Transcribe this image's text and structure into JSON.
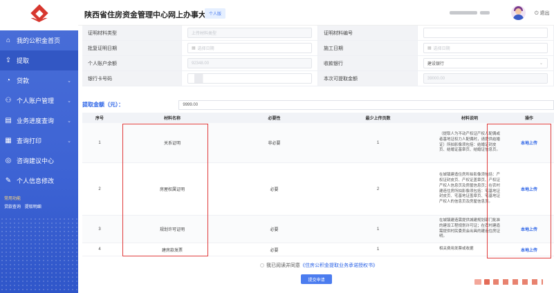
{
  "sidebar": {
    "items": [
      {
        "label": "我的公积金首页",
        "icon": "home-icon",
        "glyph": "⌂",
        "chevron": false
      },
      {
        "label": "提取",
        "icon": "withdraw-icon",
        "glyph": "⇪",
        "chevron": false
      },
      {
        "label": "贷款",
        "icon": "loan-icon",
        "glyph": "◔",
        "chevron": true
      },
      {
        "label": "个人账户管理",
        "icon": "user-icon",
        "glyph": "⚇",
        "chevron": true
      },
      {
        "label": "业务进度查询",
        "icon": "progress-icon",
        "glyph": "▤",
        "chevron": true
      },
      {
        "label": "查询打印",
        "icon": "print-icon",
        "glyph": "▦",
        "chevron": true
      },
      {
        "label": "咨询建议中心",
        "icon": "chat-icon",
        "glyph": "◎",
        "chevron": false
      },
      {
        "label": "个人信息修改",
        "icon": "edit-icon",
        "glyph": "✎",
        "chevron": false
      }
    ],
    "common_title": "常用功能",
    "common_links": [
      "贷款查询",
      "提取明细"
    ]
  },
  "header": {
    "title": "陕西省住房资金管理中心网上办事大厅",
    "badge": "个人版",
    "logout": "退出"
  },
  "form": {
    "rows": [
      [
        {
          "label": "证明材料类型",
          "value": "上传材料类型",
          "kind": "disabled"
        },
        {
          "label": "证明材料编号",
          "value": "",
          "kind": "input"
        }
      ],
      [
        {
          "label": "批复证明日期",
          "value": "选择日期",
          "kind": "date"
        },
        {
          "label": "施工日期",
          "value": "选择日期",
          "kind": "date"
        }
      ],
      [
        {
          "label": "个人账户余额",
          "value": "92348.00",
          "kind": "disabled"
        },
        {
          "label": "收款银行",
          "value": "建设银行",
          "kind": "select"
        }
      ],
      [
        {
          "label": "银行卡号码",
          "value": "",
          "kind": "blur"
        },
        {
          "label": "本次可提取金额",
          "value": "39000.00",
          "kind": "disabled"
        }
      ]
    ]
  },
  "amount": {
    "label": "提取金额（元）：",
    "value": "9999.00"
  },
  "table": {
    "headers": [
      "序号",
      "材料名称",
      "必要性",
      "最少上传页数",
      "材料说明",
      "操作"
    ],
    "rows": [
      {
        "no": "1",
        "name": "关系证明",
        "need": "非必要",
        "pages": "1",
        "desc": "（提取人为不动产权证产权人配偶或者基地证权力人配偶时，请提供结婚证）所拍影像须包括：结婚证封皮页、结婚证基章页、结婚证信息页。",
        "action": "本地上传"
      },
      {
        "no": "2",
        "name": "房屋权属证明",
        "need": "必要",
        "pages": "2",
        "desc": "在城镇建造住房所拍影像须包括：产权证封皮页、产权证盖章页、产权证产权人信息页及房屋信息页；在农村建造住房所拍影像须包括：宅基地证封皮页、宅基地证盖章页、宅基地证产权人的信息页及房屋信息页。",
        "action": "本地上传"
      },
      {
        "no": "3",
        "name": "规划许可证明",
        "need": "必要",
        "pages": "1",
        "desc": "在城镇建造需提供城建规划部门批准的建设工程规划许可证；在农村建造需提供村民委员会出具的建造住房证明。",
        "action": "本地上传"
      },
      {
        "no": "4",
        "name": "建房款发票",
        "need": "必要",
        "pages": "1",
        "desc": "相关费用发票或收据",
        "action": "本地上传"
      }
    ]
  },
  "agreement": {
    "text": "我已阅读并同意",
    "link": "《住房公积金提取业务承诺授权书》"
  },
  "submit": "提交申请"
}
